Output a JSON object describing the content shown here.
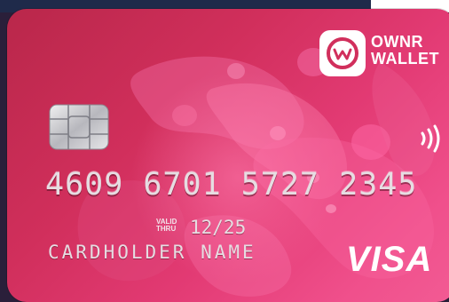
{
  "card": {
    "brand_top": "OWNR",
    "brand_bottom": "WALLET",
    "number": "4609 6701 5727 2345",
    "valid_label_top": "VALID",
    "valid_label_bottom": "THRU",
    "expiry": "12/25",
    "cardholder": "CARDHOLDER NAME",
    "network": "VISA"
  },
  "icons": {
    "logo": "ownr-logo-icon",
    "chip": "emv-chip-icon",
    "contactless": "contactless-icon"
  },
  "colors": {
    "card_gradient_start": "#b9274a",
    "card_gradient_end": "#f25b94",
    "text_embossed": "#e6dde2",
    "logo_text": "#ffffff"
  }
}
